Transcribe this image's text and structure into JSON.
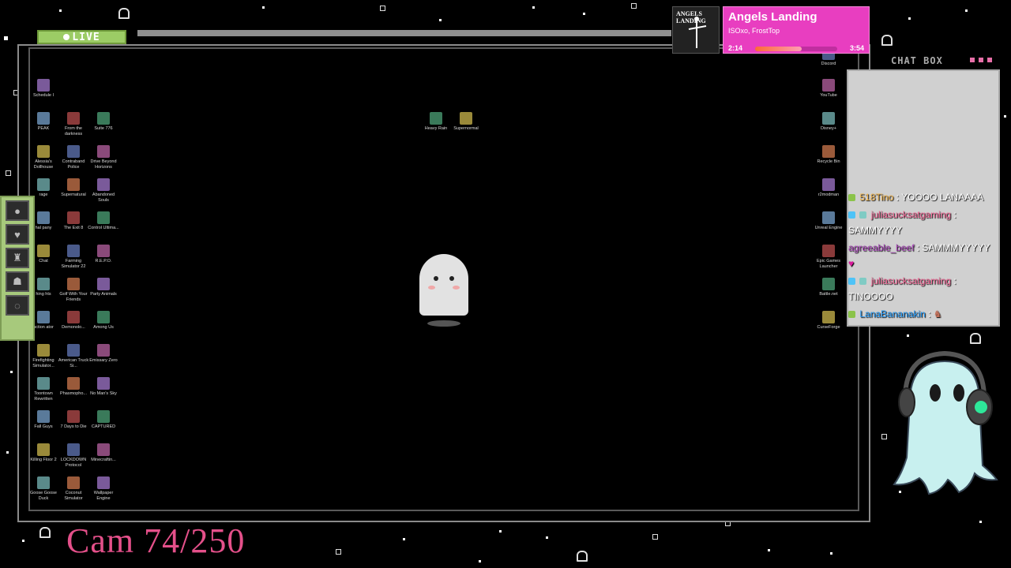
{
  "stream": {
    "live_label": "LIVE",
    "cam_counter": "Cam 74/250"
  },
  "music": {
    "album_text": "ANGELS LANDING",
    "title": "Angels Landing",
    "artist": "ISOxo, FrostTop",
    "time_elapsed": "2:14",
    "time_total": "3:54",
    "progress": 0.57,
    "accent_color": "#e83ec0"
  },
  "chat": {
    "title": "CHAT BOX",
    "messages": [
      {
        "user": "518Tino",
        "text": ": YOOOO LANAAAA"
      },
      {
        "user": "juliasucksatgaming",
        "text": ":"
      },
      {
        "user": "",
        "text": "SAMMYYYY"
      },
      {
        "user": "agreeable_beef",
        "text": ": SAMMMYYYYY"
      },
      {
        "user": "juliasucksatgaming",
        "text": ":"
      },
      {
        "user": "",
        "text": "TINOOOO"
      },
      {
        "user": "LanaBananakin",
        "text": ":"
      }
    ]
  },
  "desktop": {
    "left_icons": [
      "Schedule I",
      "PEAK",
      "From the darkness",
      "Suite 776",
      "Alessia's Dollhouse",
      "Contraband Police",
      "Drive Beyond Horizons",
      "rage",
      "Supernatural",
      "Abandoned Souls",
      "hal pany",
      "The Exit 8",
      "Control Ultima...",
      "Chat",
      "Farming Simulator 22",
      "R.E.P.O.",
      "hing hts",
      "Golf With Your Friends",
      "Party Animals",
      "uction ator",
      "Demonolo...",
      "Among Us",
      "Firefighting Simulator...",
      "American Truck Si...",
      "Emissary Zero",
      "Toontown Rewritten",
      "Phasmopho...",
      "No Man's Sky",
      "Fall Guys",
      "7 Days to Die",
      "CAPTURED",
      "Killing Floor 2",
      "LOCKDOWN Protocol",
      "Minecraftin...",
      "Goose Goose Duck",
      "Coconut Simulator",
      "Wallpaper Engine"
    ],
    "center_icons": [
      "Heavy Rain",
      "Supernormal"
    ],
    "right_icons": [
      "Discord",
      "YouTube",
      "Disney+",
      "Recycle Bin",
      "r2modman",
      "Unreal Engine",
      "Epic Games Launcher",
      "Battle.net",
      "CurseForge"
    ]
  }
}
